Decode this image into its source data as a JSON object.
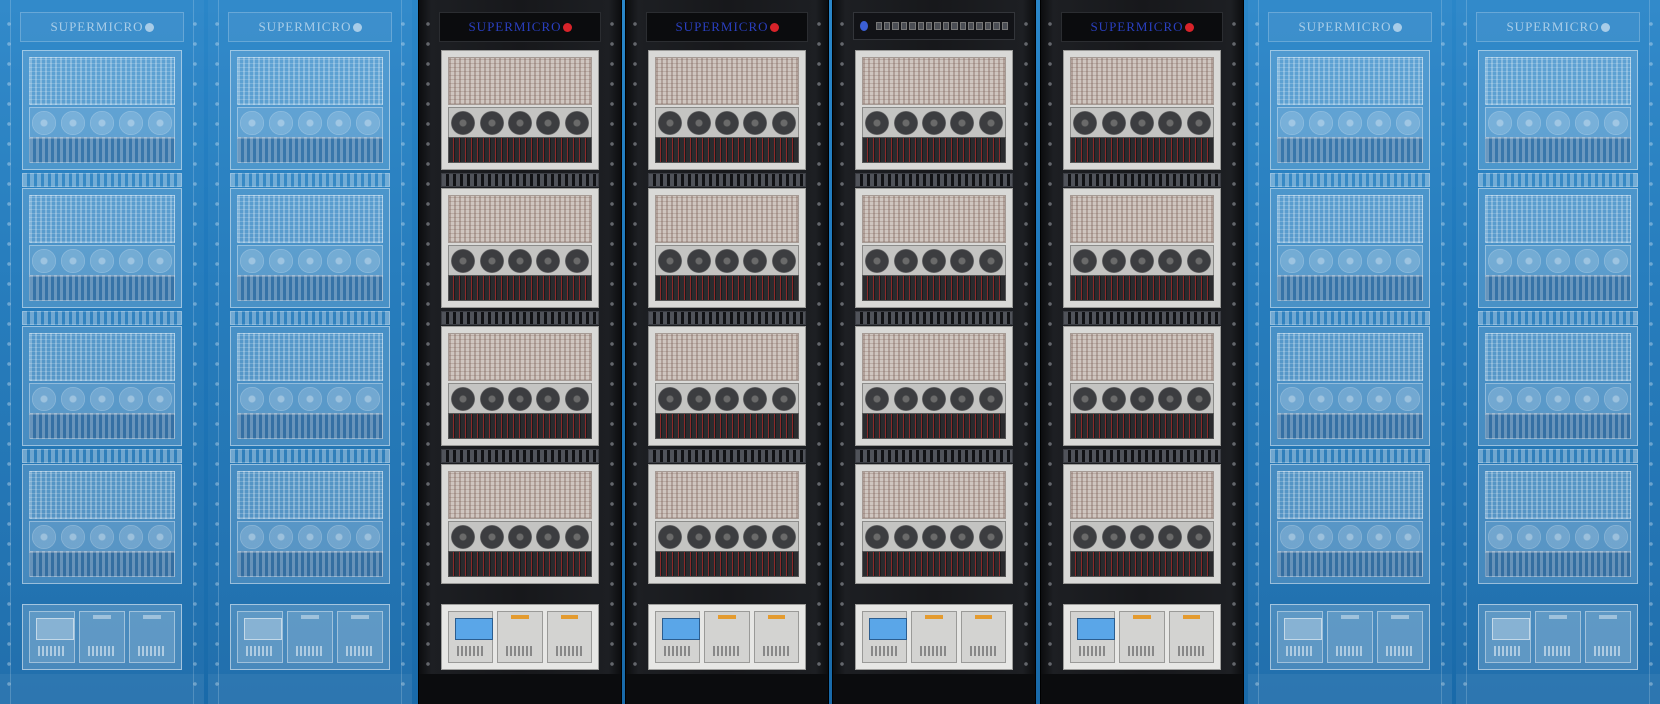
{
  "brand_text": "SUPERMICRO",
  "racks": [
    {
      "style": "ghost",
      "top": "brand"
    },
    {
      "style": "ghost",
      "top": "brand"
    },
    {
      "style": "dark",
      "top": "brand"
    },
    {
      "style": "dark",
      "top": "brand"
    },
    {
      "style": "dark",
      "top": "switch"
    },
    {
      "style": "dark",
      "top": "brand"
    },
    {
      "style": "ghost",
      "top": "brand"
    },
    {
      "style": "ghost",
      "top": "brand"
    }
  ],
  "colors": {
    "background": "#1f78bb",
    "rack_dark": "#17181b",
    "brand_blue": "#2a3fbf",
    "brand_red": "#d8232a",
    "lcd_blue": "#5aa6e8"
  }
}
